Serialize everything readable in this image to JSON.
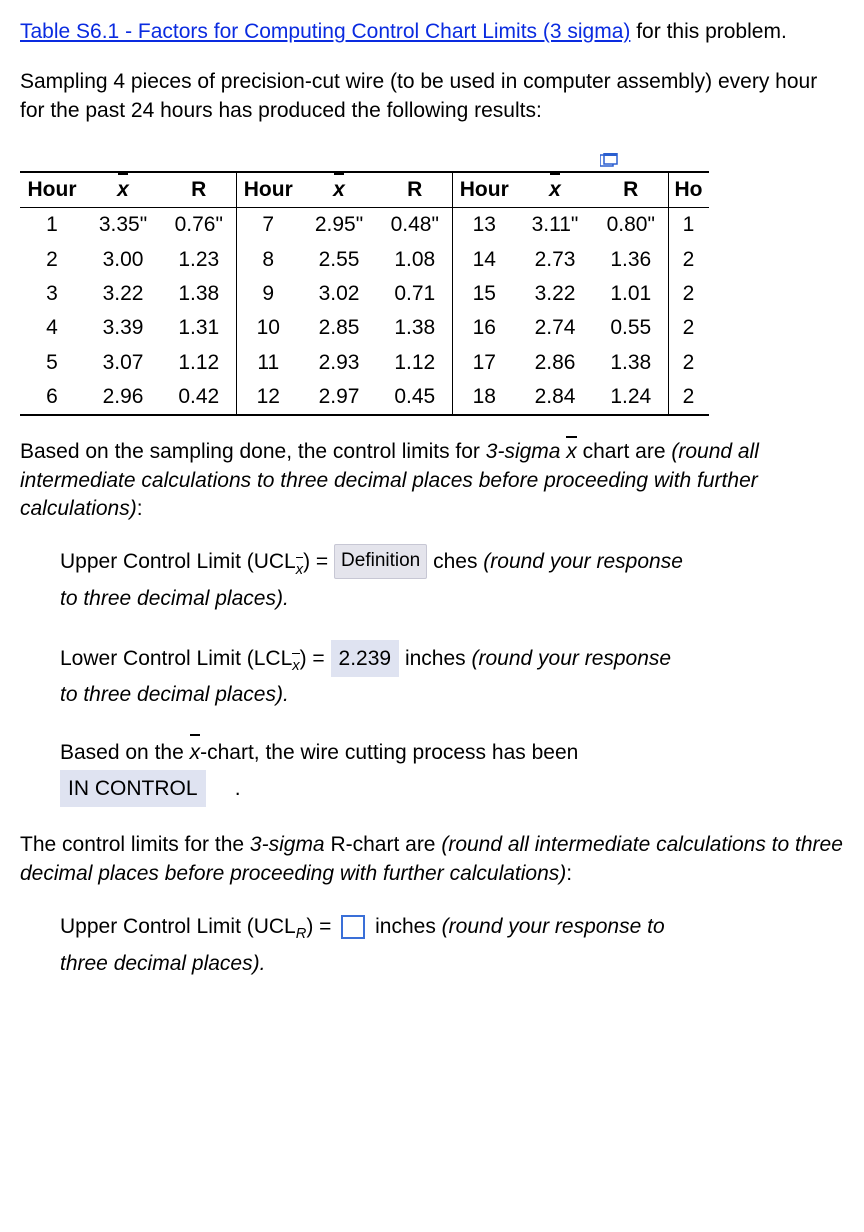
{
  "intro": {
    "link_text": "Table S6.1 - Factors for Computing Control Chart Limits (3 sigma)",
    "after_link": " for this problem.",
    "sampling_text": "Sampling 4 pieces of precision-cut wire (to be used in computer assembly) every hour for the past 24 hours has produced the following results:"
  },
  "table": {
    "headers": {
      "hour": "Hour",
      "x": "x",
      "r": "R",
      "h4": "Ho"
    },
    "rows": [
      {
        "h1": "1",
        "x1": "3.35\"",
        "r1": "0.76\"",
        "h2": "7",
        "x2": "2.95\"",
        "r2": "0.48\"",
        "h3": "13",
        "x3": "3.11\"",
        "r3": "0.80\"",
        "h4": "1"
      },
      {
        "h1": "2",
        "x1": "3.00",
        "r1": "1.23",
        "h2": "8",
        "x2": "2.55",
        "r2": "1.08",
        "h3": "14",
        "x3": "2.73",
        "r3": "1.36",
        "h4": "2"
      },
      {
        "h1": "3",
        "x1": "3.22",
        "r1": "1.38",
        "h2": "9",
        "x2": "3.02",
        "r2": "0.71",
        "h3": "15",
        "x3": "3.22",
        "r3": "1.01",
        "h4": "2"
      },
      {
        "h1": "4",
        "x1": "3.39",
        "r1": "1.31",
        "h2": "10",
        "x2": "2.85",
        "r2": "1.38",
        "h3": "16",
        "x3": "2.74",
        "r3": "0.55",
        "h4": "2"
      },
      {
        "h1": "5",
        "x1": "3.07",
        "r1": "1.12",
        "h2": "11",
        "x2": "2.93",
        "r2": "1.12",
        "h3": "17",
        "x3": "2.86",
        "r3": "1.38",
        "h4": "2"
      },
      {
        "h1": "6",
        "x1": "2.96",
        "r1": "0.42",
        "h2": "12",
        "x2": "2.97",
        "r2": "0.45",
        "h3": "18",
        "x3": "2.84",
        "r3": "1.24",
        "h4": "2"
      }
    ]
  },
  "q1": {
    "lead1": "Based on the sampling done, the control limits for ",
    "sigma": "3-sigma ",
    "lead2": " chart are ",
    "note": "(round all intermediate calculations to three decimal places before proceeding with further calculations)",
    "colon": ":"
  },
  "ucl_x": {
    "label_a": "Upper Control Limit (UCL",
    "label_b": ") = ",
    "tooltip": "Definition",
    "after": " ches ",
    "note": "(round your response to three decimal places).",
    "to_line": "to three decimal places)."
  },
  "lcl_x": {
    "label_a": "Lower Control Limit (LCL",
    "label_b": ") = ",
    "value": "2.239",
    "after": " inches ",
    "note_a": "(round your response",
    "to_line": "to three decimal places)."
  },
  "status": {
    "lead_a": "Based on the ",
    "lead_b": "-chart, the wire cutting process has been",
    "value": "IN CONTROL",
    "period": "."
  },
  "q2": {
    "lead": "The control limits for the ",
    "sigma": "3-sigma",
    "mid": " R-chart are ",
    "note": "(round all intermediate calculations to three decimal places before proceeding with further calculations)",
    "colon": ":"
  },
  "ucl_r": {
    "label_a": "Upper Control Limit (UCL",
    "sub": "R",
    "label_b": ") = ",
    "after": " inches ",
    "note": "(round your response to",
    "to_line": "three decimal places)."
  },
  "chart_data": {
    "type": "table",
    "title": "Hourly sample means and ranges",
    "columns": [
      "Hour",
      "x̄",
      "R"
    ],
    "rows": [
      [
        1,
        3.35,
        0.76
      ],
      [
        2,
        3.0,
        1.23
      ],
      [
        3,
        3.22,
        1.38
      ],
      [
        4,
        3.39,
        1.31
      ],
      [
        5,
        3.07,
        1.12
      ],
      [
        6,
        2.96,
        0.42
      ],
      [
        7,
        2.95,
        0.48
      ],
      [
        8,
        2.55,
        1.08
      ],
      [
        9,
        3.02,
        0.71
      ],
      [
        10,
        2.85,
        1.38
      ],
      [
        11,
        2.93,
        1.12
      ],
      [
        12,
        2.97,
        0.45
      ],
      [
        13,
        3.11,
        0.8
      ],
      [
        14,
        2.73,
        1.36
      ],
      [
        15,
        3.22,
        1.01
      ],
      [
        16,
        2.74,
        0.55
      ],
      [
        17,
        2.86,
        1.38
      ],
      [
        18,
        2.84,
        1.24
      ]
    ]
  }
}
